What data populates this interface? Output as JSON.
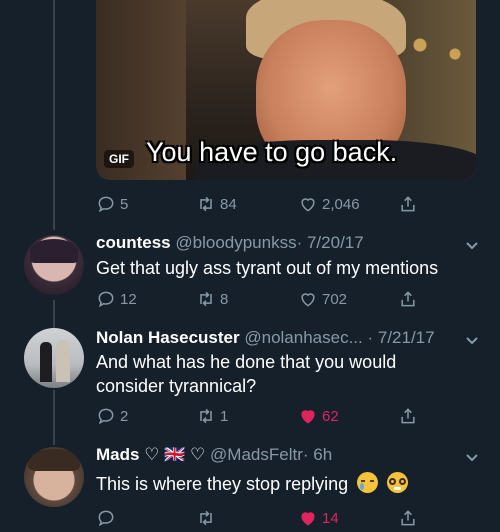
{
  "media": {
    "badge": "GIF",
    "caption": "You have to go back."
  },
  "top_actions": {
    "replies": "5",
    "retweets": "84",
    "likes": "2,046"
  },
  "tweets": [
    {
      "name": "countess",
      "handle": "@bloodypunkss",
      "time": "· 7/20/17",
      "text": "Get that ugly ass tyrant out of my mentions",
      "replies": "12",
      "retweets": "8",
      "likes": "702",
      "liked": false
    },
    {
      "name": "Nolan Hasecuster",
      "handle": "@nolanhasec...",
      "time": "· 7/21/17",
      "text_line1": "And what has he done that you would",
      "text_line2": "consider tyrannical?",
      "replies": "2",
      "retweets": "1",
      "likes": "62",
      "liked": true
    },
    {
      "name": "Mads",
      "name_decoration": "♡ 🇬🇧 ♡",
      "handle": "@MadsFeltr",
      "time": "· 6h",
      "text": "This is where they stop replying",
      "replies": "",
      "retweets": "",
      "likes": "14",
      "liked": true
    }
  ],
  "colors": {
    "background": "#15202b",
    "secondary_text": "#8899a6",
    "like_active": "#e0245e",
    "thread_line": "#38444d"
  }
}
